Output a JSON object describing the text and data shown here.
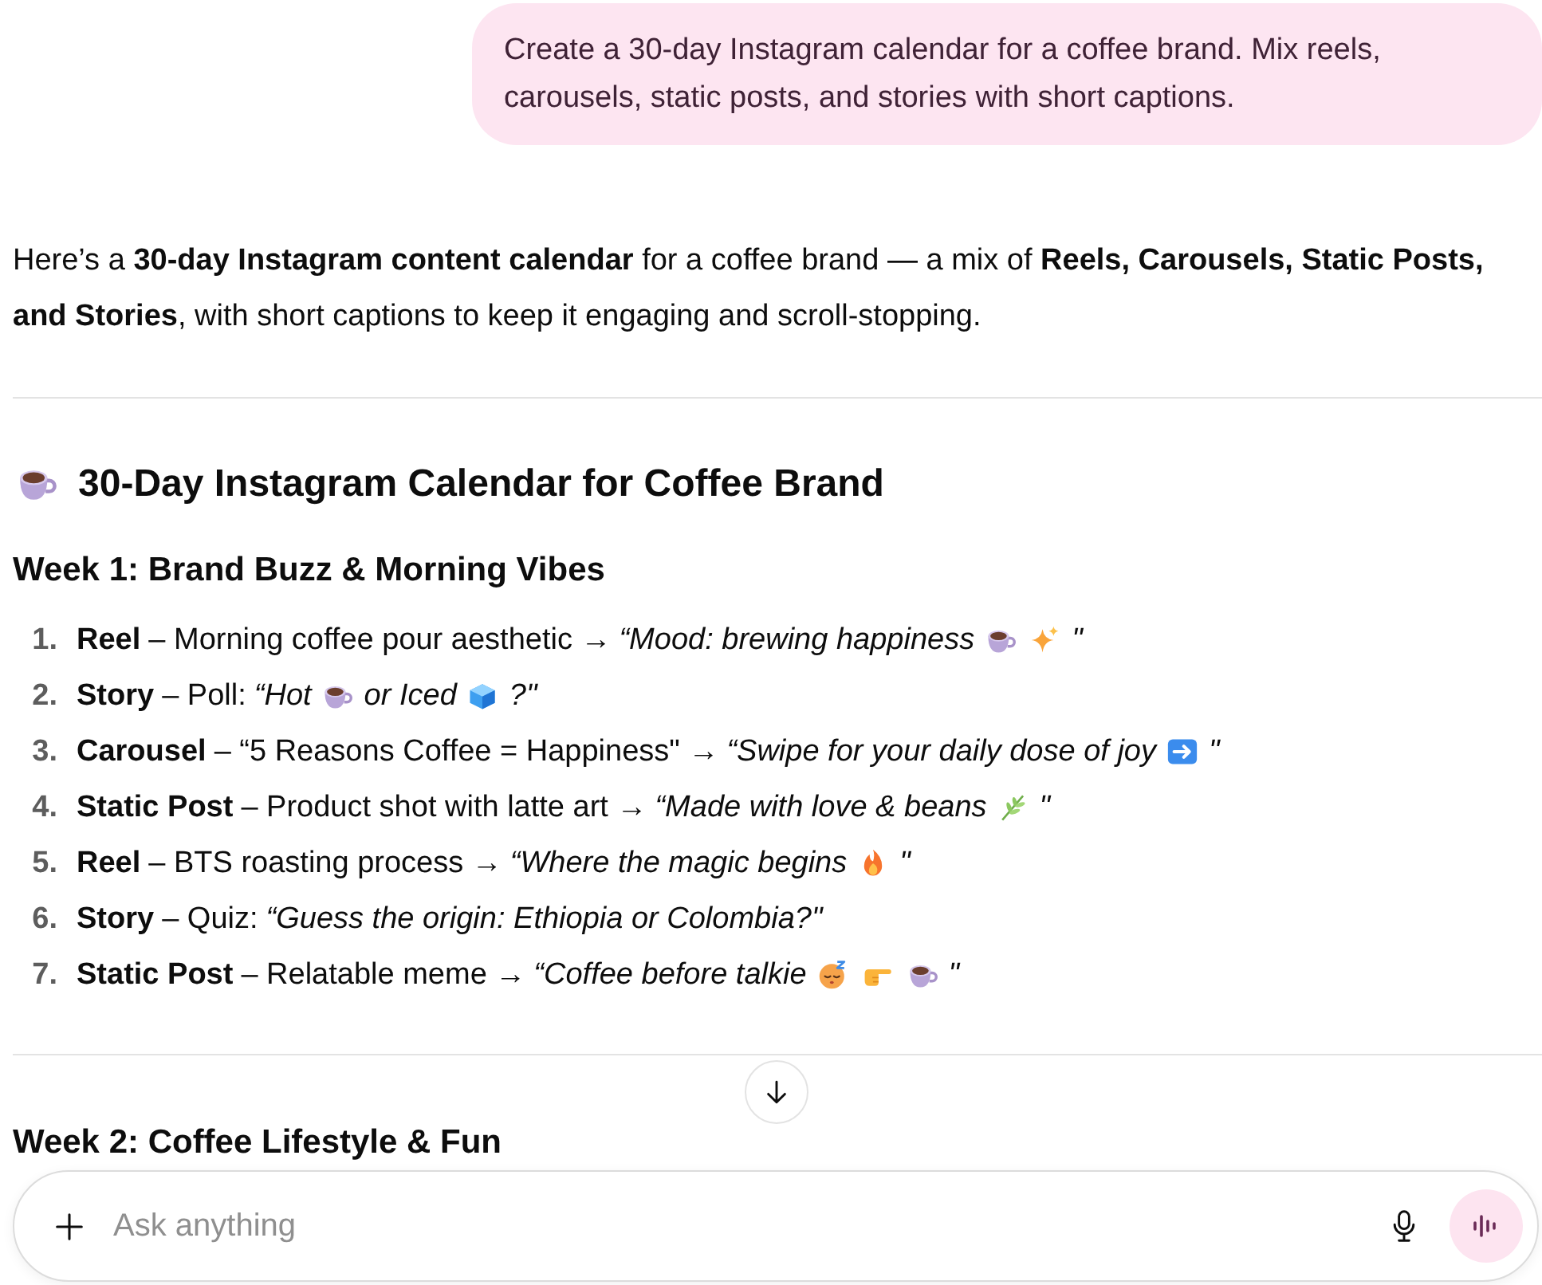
{
  "user_message": {
    "text": "Create a 30-day Instagram calendar for a coffee brand. Mix reels, carousels, static posts, and stories with short captions."
  },
  "response": {
    "intro": "Here’s a **30-day Instagram content calendar** for a coffee brand — a mix of **Reels, Carousels, Static Posts, and Stories**, with short captions to keep it engaging and scroll-stopping.",
    "title": "30-Day Instagram Calendar for Coffee Brand",
    "sections": [
      {
        "heading": "Week 1: Brand Buzz & Morning Vibes",
        "items": [
          {
            "number": "1.",
            "format": "Reel",
            "description": "– Morning coffee pour aesthetic →",
            "caption": [
              {
                "kind": "text",
                "text": "“Mood: brewing happiness"
              },
              {
                "kind": "coffee"
              },
              {
                "kind": "sparkles"
              },
              {
                "kind": "text",
                "text": "\""
              }
            ]
          },
          {
            "number": "2.",
            "format": "Story",
            "description": "– Poll:",
            "caption": [
              {
                "kind": "text",
                "text": "“Hot"
              },
              {
                "kind": "coffee"
              },
              {
                "kind": "text",
                "text": "or Iced"
              },
              {
                "kind": "ice"
              },
              {
                "kind": "text",
                "text": "?\""
              }
            ]
          },
          {
            "number": "3.",
            "format": "Carousel",
            "description": "– “5 Reasons Coffee = Happiness\" →",
            "caption": [
              {
                "kind": "text",
                "text": "“Swipe for your daily dose of joy"
              },
              {
                "kind": "arrow"
              },
              {
                "kind": "text",
                "text": "\""
              }
            ]
          },
          {
            "number": "4.",
            "format": "Static Post",
            "description": "– Product shot with latte art →",
            "caption": [
              {
                "kind": "text",
                "text": "“Made with love & beans"
              },
              {
                "kind": "herb"
              },
              {
                "kind": "text",
                "text": "\""
              }
            ]
          },
          {
            "number": "5.",
            "format": "Reel",
            "description": "– BTS roasting process →",
            "caption": [
              {
                "kind": "text",
                "text": "“Where the magic begins"
              },
              {
                "kind": "fire"
              },
              {
                "kind": "text",
                "text": "\""
              }
            ]
          },
          {
            "number": "6.",
            "format": "Story",
            "description": "– Quiz:",
            "caption": [
              {
                "kind": "text",
                "text": "“Guess the origin: Ethiopia or Colombia?\""
              }
            ]
          },
          {
            "number": "7.",
            "format": "Static Post",
            "description": "– Relatable meme →",
            "caption": [
              {
                "kind": "text",
                "text": "“Coffee before talkie"
              },
              {
                "kind": "sleepy"
              },
              {
                "kind": "pointing"
              },
              {
                "kind": "coffee"
              },
              {
                "kind": "text",
                "text": "\""
              }
            ]
          }
        ]
      },
      {
        "heading": "Week 2: Coffee Lifestyle & Fun"
      }
    ]
  },
  "composer": {
    "placeholder": "Ask anything"
  }
}
